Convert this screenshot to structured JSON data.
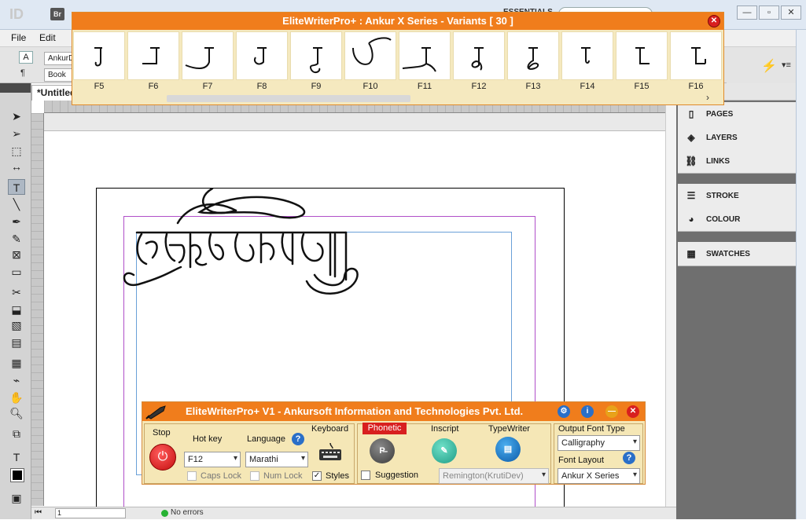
{
  "app": {
    "logo": "ID",
    "bridge": "Br",
    "workspace": "ESSENTIALS"
  },
  "menu": [
    {
      "label": "File"
    },
    {
      "label": "Edit"
    }
  ],
  "control_panel": {
    "font_field": "AnkurD",
    "style_field": "Book"
  },
  "document": {
    "tab_label": "*Untitled",
    "page_number": "1",
    "status": "No errors"
  },
  "right_panels": {
    "group1": [
      {
        "label": "PAGES",
        "icon": "pages-icon"
      },
      {
        "label": "LAYERS",
        "icon": "layers-icon"
      },
      {
        "label": "LINKS",
        "icon": "links-icon"
      }
    ],
    "group2": [
      {
        "label": "STROKE",
        "icon": "stroke-icon"
      },
      {
        "label": "COLOUR",
        "icon": "colour-icon"
      }
    ],
    "group3": [
      {
        "label": "SWATCHES",
        "icon": "swatches-icon"
      }
    ]
  },
  "variants_popup": {
    "title": "EliteWriterPro+ : Ankur X Series - Variants [ 30 ]",
    "items": [
      {
        "key": "F5"
      },
      {
        "key": "F6"
      },
      {
        "key": "F7"
      },
      {
        "key": "F8"
      },
      {
        "key": "F9"
      },
      {
        "key": "F10"
      },
      {
        "key": "F11"
      },
      {
        "key": "F12"
      },
      {
        "key": "F13"
      },
      {
        "key": "F14"
      },
      {
        "key": "F15"
      },
      {
        "key": "F16"
      }
    ]
  },
  "elitewriter": {
    "title": "EliteWriterPro+ V1 - Ankursoft Information and Technologies Pvt. Ltd.",
    "stop_label": "Stop",
    "hotkey_label": "Hot key",
    "hotkey_value": "F12",
    "language_label": "Language",
    "language_value": "Marathi",
    "keyboard_label": "Keyboard",
    "caps_lock": "Caps Lock",
    "num_lock": "Num Lock",
    "styles_label": "Styles",
    "phonetic_label": "Phonetic",
    "phonetic_icon_text": "P̶",
    "inscript_label": "Inscript",
    "typewriter_label": "TypeWriter",
    "suggestion_label": "Suggestion",
    "remington_value": "Remington(KrutiDev)",
    "output_font_type_label": "Output  Font  Type",
    "output_font_type_value": "Calligraphy",
    "font_layout_label": "Font Layout",
    "font_layout_value": "Ankur X Series",
    "styles_checked": true,
    "suggestion_checked": false
  },
  "colors": {
    "orange_bar": "#f07d1c",
    "panel_bg": "#f5e7b6",
    "close_red": "#d81f1f"
  }
}
